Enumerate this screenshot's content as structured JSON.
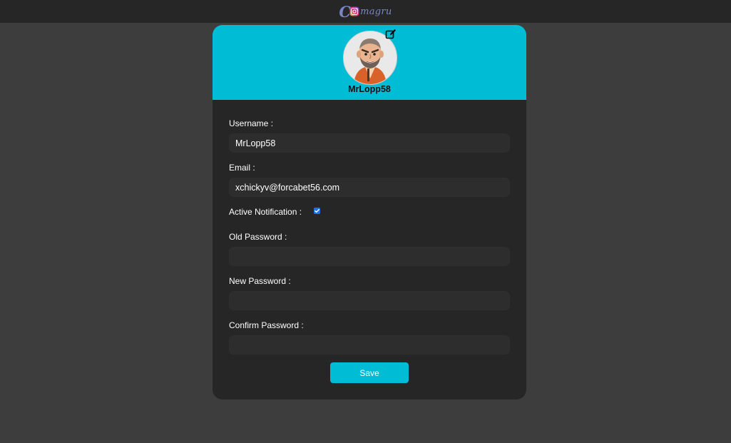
{
  "header": {
    "logo_initial": "C",
    "logo_rest": "magru"
  },
  "profile": {
    "username_display": "MrLopp58"
  },
  "form": {
    "username_label": "Username :",
    "username_value": "MrLopp58",
    "email_label": "Email :",
    "email_value": "xchickyv@forcabet56.com",
    "notification_label": "Active Notification :",
    "notification_checked": true,
    "old_password_label": "Old Password :",
    "old_password_value": "",
    "new_password_label": "New Password :",
    "new_password_value": "",
    "confirm_password_label": "Confirm Password :",
    "confirm_password_value": "",
    "save_label": "Save"
  },
  "icons": {
    "edit": "edit-icon",
    "avatar": "avatar-image",
    "logo": "camagru-logo"
  },
  "colors": {
    "accent": "#00bcd4",
    "page_bg": "#3d3d3d",
    "card_bg": "#262626",
    "topbar_bg": "#262626",
    "input_bg": "#2d2d2d",
    "checkbox": "#1a73e8",
    "logo": "#7b86c8"
  }
}
